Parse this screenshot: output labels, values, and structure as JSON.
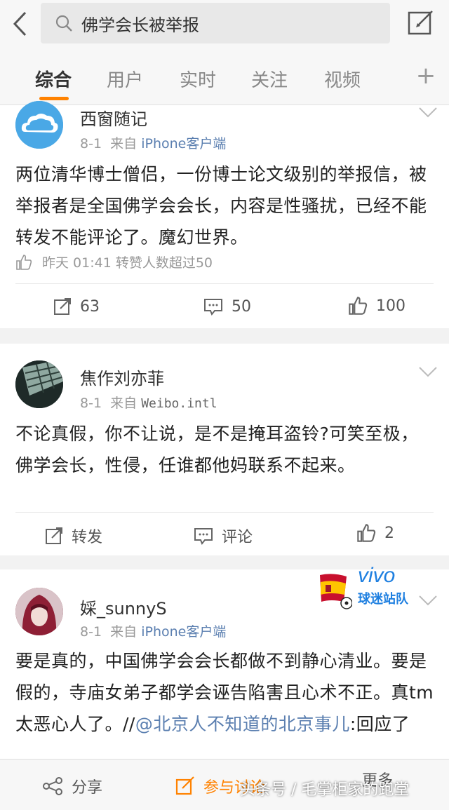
{
  "search": {
    "query": "佛学会长被举报"
  },
  "tabs": [
    {
      "label": "综合"
    },
    {
      "label": "用户"
    },
    {
      "label": "实时"
    },
    {
      "label": "关注"
    },
    {
      "label": "视频"
    }
  ],
  "tab_add_label": "+",
  "posts": [
    {
      "author": "西窗随记",
      "date": "8-1",
      "from_label": "来自",
      "source": "iPhone客户端",
      "text": "两位清华博士僧侣，一份博士论文级别的举报信，被举报者是全国佛学会会长，内容是性骚扰，已经不能转发不能评论了。魔幻世界。",
      "likes_line": "昨天 01:41 转赞人数超过50",
      "repost": "63",
      "comment": "50",
      "like": "100"
    },
    {
      "author": "焦作刘亦菲",
      "date": "8-1",
      "from_label": "来自",
      "source": "Weibo.intl",
      "text": "不论真假，你不让说，是不是掩耳盗铃?可笑至极，佛学会长，性侵，任谁都他妈联系不起来。",
      "repost": "转发",
      "comment": "评论",
      "like": "2"
    },
    {
      "author": "婇_sunnyS",
      "date": "8-1",
      "from_label": "来自",
      "source": "iPhone客户端",
      "text_before": "要是真的，中国佛学会会长都做不到静心清业。要是假的，寺庙女弟子都学会诬告陷害且心术不正。真tm太恶心人了。//",
      "mention": "@北京人不知道的北京事儿",
      "text_after": ":回应了"
    }
  ],
  "badge": {
    "brand": "vivo",
    "team": "球迷站队"
  },
  "bottom": {
    "share": "分享",
    "participate": "参与讨论",
    "more": "更多"
  },
  "watermark": "头条号 / 毛掌柜家的跑堂",
  "colors": {
    "accent": "#ff8200",
    "link": "#5b7fb0",
    "vivo": "#1e7fe0"
  }
}
